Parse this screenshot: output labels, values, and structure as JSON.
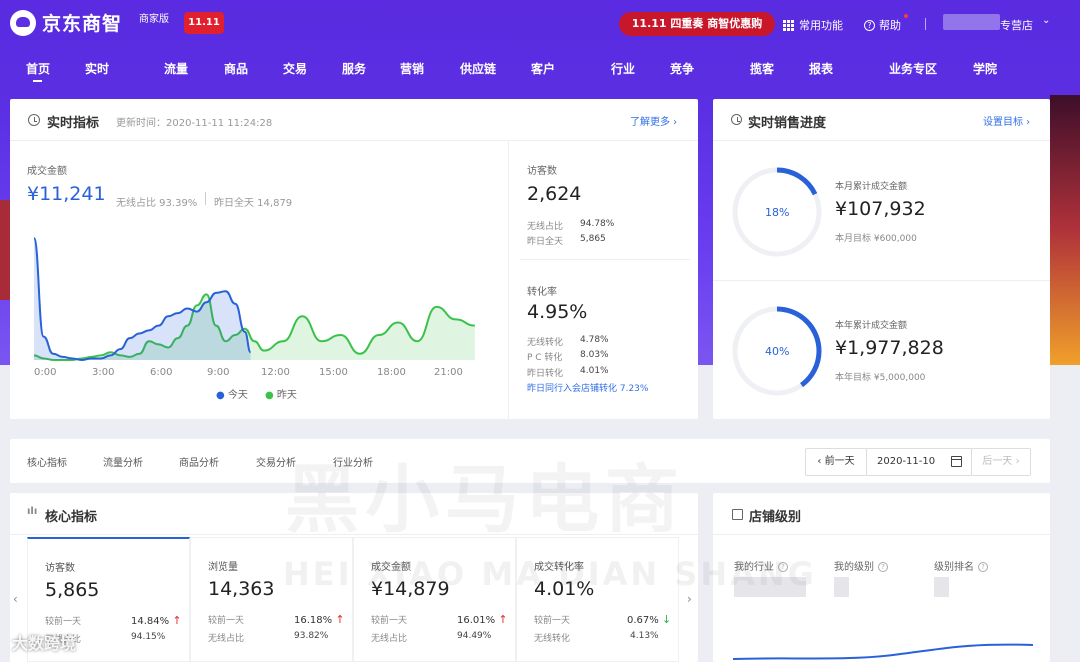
{
  "topbar": {
    "logo_text": "京东商智",
    "edition": "商家版",
    "badge": "11.11",
    "promo": "11.11 四重奏 商智优惠购",
    "common_features": "常用功能",
    "help": "帮助",
    "store_suffix": "专营店"
  },
  "nav": {
    "items": [
      "首页",
      "实时",
      "流量",
      "商品",
      "交易",
      "服务",
      "营销",
      "供应链",
      "客户",
      "行业",
      "竞争",
      "揽客",
      "报表",
      "业务专区",
      "学院"
    ]
  },
  "realtime": {
    "title": "实时指标",
    "update_time": "更新时间：2020-11-11 11:24:28",
    "more_link": "了解更多 ›",
    "gmv_label": "成交金额",
    "gmv_value": "¥11,241",
    "wireless_ratio": "无线占比 93.39%",
    "yesterday_full": "昨日全天 14,879",
    "visitors_label": "访客数",
    "visitors_value": "2,624",
    "v_wireless_label": "无线占比",
    "v_wireless_value": "94.78%",
    "v_yesterday_label": "昨日全天",
    "v_yesterday_value": "5,865",
    "conv_label": "转化率",
    "conv_value": "4.95%",
    "c_wireless_label": "无线转化",
    "c_wireless_value": "4.78%",
    "c_pc_label": "P C 转化",
    "c_pc_value": "8.03%",
    "c_yesterday_label": "昨日转化",
    "c_yesterday_value": "4.01%",
    "industry_link": "昨日同行入会店铺转化 7.23%",
    "x_ticks": [
      "0:00",
      "3:00",
      "6:00",
      "9:00",
      "12:00",
      "15:00",
      "18:00",
      "21:00"
    ],
    "legend_today": "今天",
    "legend_yesterday": "昨天",
    "color_today": "#2961d8",
    "color_yesterday": "#3bc24a"
  },
  "chart_data": {
    "type": "area",
    "xlabel": "",
    "ylabel": "",
    "x": [
      "0:00",
      "3:00",
      "6:00",
      "9:00",
      "12:00",
      "15:00",
      "18:00",
      "21:00"
    ],
    "series": [
      {
        "name": "今天",
        "x": [
          0,
          0.5,
          1,
          1.5,
          2,
          2.5,
          3,
          3.5,
          4,
          4.5,
          5,
          5.5,
          6,
          6.5,
          7,
          7.5,
          8,
          8.5,
          9,
          9.5,
          10,
          10.5,
          11,
          11.3
        ],
        "values": [
          78,
          15,
          4,
          2,
          1,
          0,
          1,
          1,
          3,
          7,
          14,
          17,
          19,
          22,
          28,
          30,
          33,
          31,
          37,
          43,
          44,
          36,
          18,
          5
        ]
      },
      {
        "name": "昨天",
        "x": [
          0,
          0.5,
          1,
          1.5,
          2,
          2.5,
          3,
          3.5,
          4,
          4.5,
          5,
          5.5,
          6,
          6.5,
          7,
          7.5,
          8,
          8.5,
          9,
          9.5,
          10,
          10.5,
          11,
          11.5,
          12,
          13,
          14,
          15,
          16,
          17,
          18,
          19,
          20,
          21,
          22,
          23
        ],
        "values": [
          3,
          1,
          0,
          0,
          0,
          1,
          2,
          3,
          5,
          3,
          2,
          4,
          12,
          10,
          8,
          14,
          22,
          35,
          42,
          22,
          12,
          16,
          20,
          12,
          6,
          12,
          28,
          12,
          16,
          4,
          16,
          24,
          12,
          34,
          26,
          22
        ]
      }
    ]
  },
  "progress": {
    "title": "实时销售进度",
    "set_target": "设置目标 ›",
    "month_pct": "18%",
    "month_fraction": 0.18,
    "month_label": "本月累计成交金额",
    "month_value": "¥107,932",
    "month_target": "本月目标 ¥600,000",
    "year_pct": "40%",
    "year_fraction": 0.4,
    "year_label": "本年累计成交金额",
    "year_value": "¥1,977,828",
    "year_target": "本年目标 ¥5,000,000"
  },
  "tabs": {
    "items": [
      "核心指标",
      "流量分析",
      "商品分析",
      "交易分析",
      "行业分析"
    ],
    "prev_day": "‹ 前一天",
    "date": "2020-11-10",
    "next_day": "后一天 ›"
  },
  "core": {
    "title": "核心指标",
    "metrics": [
      {
        "title": "访客数",
        "value": "5,865",
        "l1": "较前一天",
        "v1": "14.84%",
        "dir": "up",
        "l2": "无线占比",
        "v2": "94.15%"
      },
      {
        "title": "浏览量",
        "value": "14,363",
        "l1": "较前一天",
        "v1": "16.18%",
        "dir": "up",
        "l2": "无线占比",
        "v2": "93.82%"
      },
      {
        "title": "成交金额",
        "value": "¥14,879",
        "l1": "较前一天",
        "v1": "16.01%",
        "dir": "up",
        "l2": "无线占比",
        "v2": "94.49%"
      },
      {
        "title": "成交转化率",
        "value": "4.01%",
        "l1": "较前一天",
        "v1": "0.67%",
        "dir": "down",
        "l2": "无线转化",
        "v2": "4.13%"
      }
    ]
  },
  "level": {
    "title": "店铺级别",
    "my_industry": "我的行业",
    "my_level": "我的级别",
    "level_rank": "级别排名"
  },
  "watermark": {
    "cn": "黑小马电商",
    "en": "HEI XIAO MA DIAN SHANG",
    "corner": "大数跨境"
  }
}
